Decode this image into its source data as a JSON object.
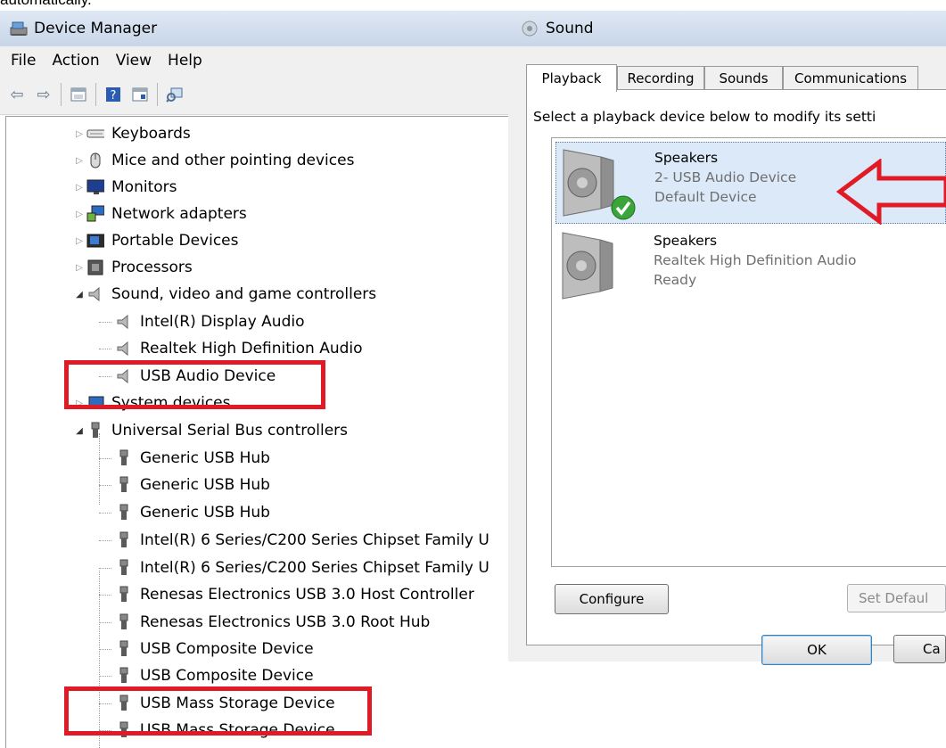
{
  "top_text": "automatically.",
  "device_manager": {
    "title": "Device Manager",
    "menu": [
      "File",
      "Action",
      "View",
      "Help"
    ],
    "tree": [
      {
        "label": "Keyboards",
        "level": 0,
        "expander": "collapsed",
        "icon": "keyboard-icon"
      },
      {
        "label": "Mice and other pointing devices",
        "level": 0,
        "expander": "collapsed",
        "icon": "mouse-icon"
      },
      {
        "label": "Monitors",
        "level": 0,
        "expander": "collapsed",
        "icon": "monitor-icon"
      },
      {
        "label": "Network adapters",
        "level": 0,
        "expander": "collapsed",
        "icon": "network-adapter-icon"
      },
      {
        "label": "Portable Devices",
        "level": 0,
        "expander": "collapsed",
        "icon": "portable-device-icon"
      },
      {
        "label": "Processors",
        "level": 0,
        "expander": "collapsed",
        "icon": "processor-icon"
      },
      {
        "label": "Sound, video and game controllers",
        "level": 0,
        "expander": "expanded",
        "icon": "speaker-icon"
      },
      {
        "label": "Intel(R) Display Audio",
        "level": 1,
        "icon": "speaker-icon"
      },
      {
        "label": "Realtek High Definition Audio",
        "level": 1,
        "icon": "speaker-icon"
      },
      {
        "label": "USB Audio Device",
        "level": 1,
        "icon": "speaker-icon",
        "highlighted": true
      },
      {
        "label": "System devices",
        "level": 0,
        "expander": "collapsed",
        "icon": "system-device-icon"
      },
      {
        "label": "Universal Serial Bus controllers",
        "level": 0,
        "expander": "expanded",
        "icon": "usb-plug-icon"
      },
      {
        "label": "Generic USB Hub",
        "level": 1,
        "icon": "usb-plug-icon"
      },
      {
        "label": "Generic USB Hub",
        "level": 1,
        "icon": "usb-plug-icon"
      },
      {
        "label": "Generic USB Hub",
        "level": 1,
        "icon": "usb-plug-icon"
      },
      {
        "label": "Intel(R) 6 Series/C200 Series Chipset Family U",
        "level": 1,
        "icon": "usb-plug-icon"
      },
      {
        "label": "Intel(R) 6 Series/C200 Series Chipset Family U",
        "level": 1,
        "icon": "usb-plug-icon"
      },
      {
        "label": "Renesas Electronics USB 3.0 Host Controller",
        "level": 1,
        "icon": "usb-plug-icon"
      },
      {
        "label": "Renesas Electronics USB 3.0 Root Hub",
        "level": 1,
        "icon": "usb-plug-icon"
      },
      {
        "label": "USB Composite Device",
        "level": 1,
        "icon": "usb-plug-icon"
      },
      {
        "label": "USB Composite Device",
        "level": 1,
        "icon": "usb-plug-icon"
      },
      {
        "label": "USB Mass Storage Device",
        "level": 1,
        "icon": "usb-plug-icon",
        "highlighted": true
      },
      {
        "label": "USB Mass Storage Device",
        "level": 1,
        "icon": "usb-plug-icon"
      }
    ]
  },
  "sound": {
    "title": "Sound",
    "tabs": [
      "Playback",
      "Recording",
      "Sounds",
      "Communications"
    ],
    "active_tab": "Playback",
    "instruction": "Select a playback device below to modify its setti",
    "devices": [
      {
        "name": "Speakers",
        "description": "2- USB Audio Device",
        "status": "Default Device",
        "selected": true,
        "default": true
      },
      {
        "name": "Speakers",
        "description": "Realtek High Definition Audio",
        "status": "Ready",
        "selected": false,
        "default": false
      }
    ],
    "buttons": {
      "configure": "Configure",
      "set_default": "Set Defaul",
      "ok": "OK",
      "cancel": "Ca"
    }
  },
  "colors": {
    "annotation_red": "#e01b26",
    "selection_blue": "#dbe9f8"
  }
}
